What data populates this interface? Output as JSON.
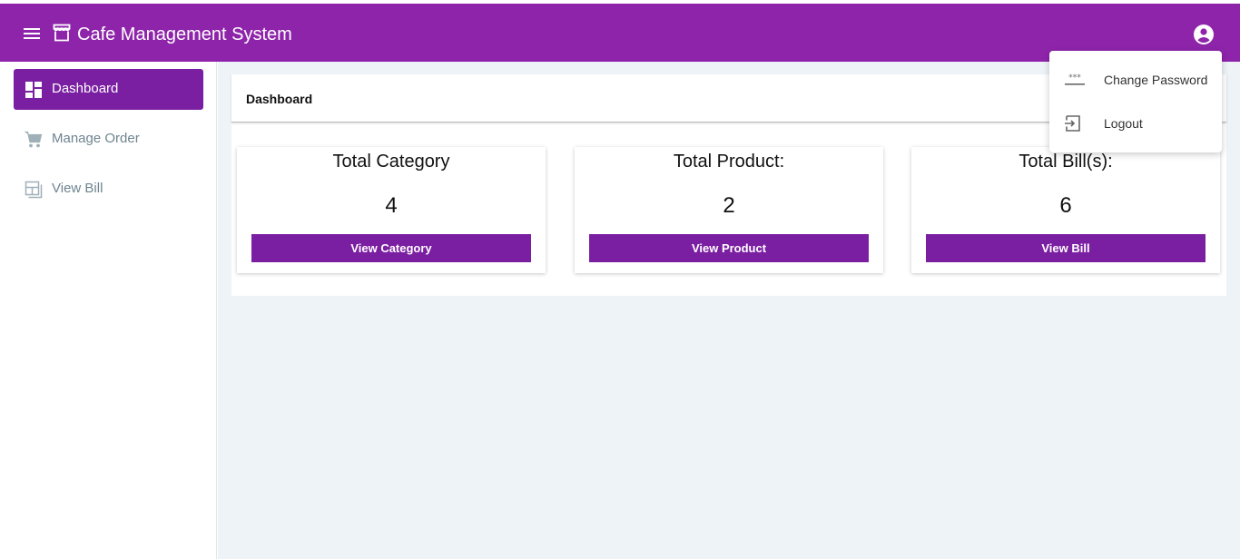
{
  "app": {
    "title": "Cafe Management System",
    "primary_color": "#8e24aa",
    "accent_color": "#7b1fa2",
    "menu_icon": "menu-icon",
    "logo_icon": "storefront-icon",
    "account_icon": "account-circle-icon"
  },
  "sidebar": {
    "items": [
      {
        "label": "Dashboard",
        "icon": "dashboard-icon",
        "active": true
      },
      {
        "label": "Manage Order",
        "icon": "shopping-cart-icon",
        "active": false
      },
      {
        "label": "View Bill",
        "icon": "bill-icon",
        "active": false
      }
    ]
  },
  "page": {
    "header_title": "Dashboard"
  },
  "cards": [
    {
      "title": "Total Category",
      "count": "4",
      "button_label": "View Category"
    },
    {
      "title": "Total Product:",
      "count": "2",
      "button_label": "View Product"
    },
    {
      "title": "Total Bill(s):",
      "count": "6",
      "button_label": "View Bill"
    }
  ],
  "account_menu": {
    "items": [
      {
        "label": "Change Password",
        "icon": "password-icon"
      },
      {
        "label": "Logout",
        "icon": "logout-icon"
      }
    ]
  }
}
